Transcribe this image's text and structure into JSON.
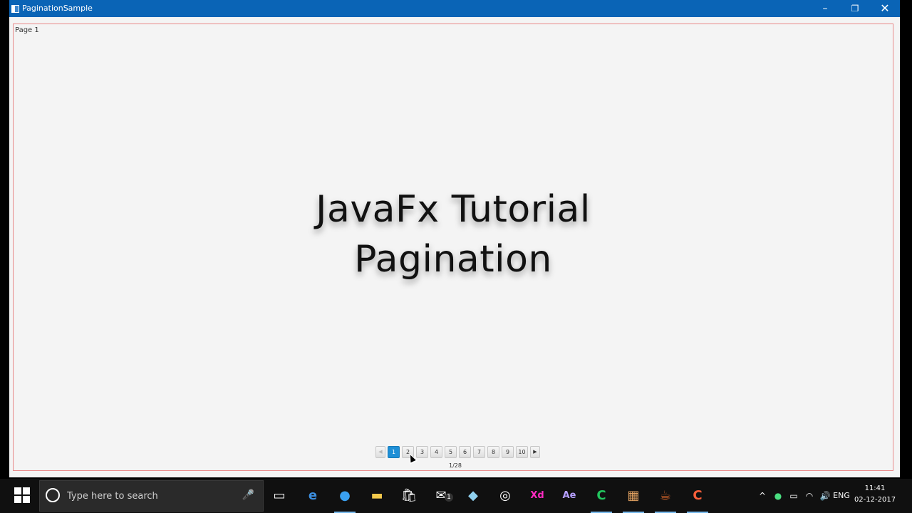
{
  "window": {
    "title": "PaginationSample",
    "controls": {
      "minimize": "–",
      "maximize": "❐",
      "close": "✕"
    }
  },
  "page": {
    "label": "Page 1",
    "heading_line1": "JavaFx Tutorial",
    "heading_line2": "Pagination"
  },
  "pagination": {
    "prev": "◀",
    "next": "▶",
    "pages": [
      "1",
      "2",
      "3",
      "4",
      "5",
      "6",
      "7",
      "8",
      "9",
      "10"
    ],
    "current_index": 0,
    "count_label": "1/28",
    "accent_color": "#1e8fd6"
  },
  "taskbar": {
    "search_placeholder": "Type here to search",
    "language": "ENG",
    "time": "11:41",
    "date": "02-12-2017",
    "mail_badge": "1"
  }
}
